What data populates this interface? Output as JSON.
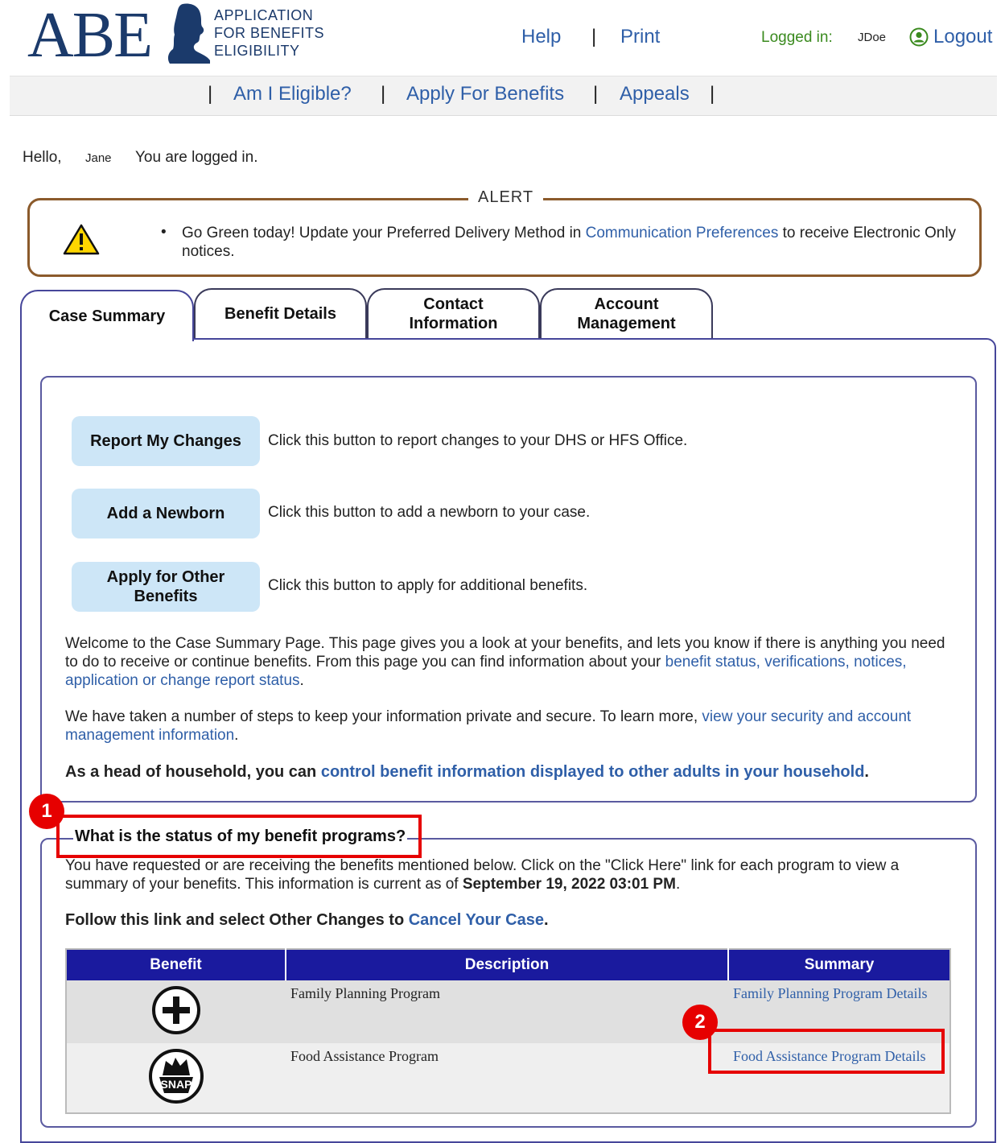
{
  "header": {
    "logo": "ABE",
    "logo_subtitle_1": "APPLICATION",
    "logo_subtitle_2": "FOR BENEFITS",
    "logo_subtitle_3": "ELIGIBILITY",
    "help": "Help",
    "separator": "|",
    "print": "Print",
    "logged_in_label": "Logged in:",
    "username": "JDoe",
    "logout": "Logout"
  },
  "nav": {
    "items": [
      "Am I Eligible?",
      "Apply For Benefits",
      "Appeals"
    ],
    "separator": "|"
  },
  "greeting": {
    "hello": "Hello,",
    "name": "Jane",
    "status": "You are logged in."
  },
  "alert": {
    "title": "ALERT",
    "bullet": "•",
    "text_before": "Go Green today! Update your Preferred Delivery Method in ",
    "link": "Communication Preferences",
    "text_after": " to receive Electronic Only notices.",
    "icon": "warning-icon"
  },
  "tabs": [
    "Case Summary",
    "Benefit Details",
    "Contact Information",
    "Account Management"
  ],
  "active_tab": "Case Summary",
  "actions": [
    {
      "label": "Report My Changes",
      "description": "Click this button to report changes to your DHS or HFS Office."
    },
    {
      "label": "Add a Newborn",
      "description": "Click this button to add a newborn to your case."
    },
    {
      "label": "Apply for Other Benefits",
      "description": "Click this button to apply for additional benefits."
    }
  ],
  "welcome": {
    "text": "Welcome to the Case Summary Page. This page gives you a look at your benefits, and lets you know if there is anything you need to do to receive or continue benefits. From this page you can find information about your ",
    "link": "benefit status, verifications, notices, application or change report status",
    "end": "."
  },
  "security": {
    "text": "We have taken a number of steps to keep your information private and secure. To learn more, ",
    "link": "view your security and account management information",
    "end": "."
  },
  "household": {
    "text": "As a head of household, you can ",
    "link": "control benefit information displayed to other adults in your household",
    "end": "."
  },
  "status_section": {
    "heading": "What is the status of my benefit programs?",
    "text": "You have requested or are receiving the benefits mentioned below. Click on the \"Click Here\" link for each program to view a summary of your benefits. This information is current as of ",
    "date": "September 19, 2022 03:01 PM",
    "end": ".",
    "cancel_text": "Follow this link and select Other Changes to ",
    "cancel_link": "Cancel Your Case",
    "cancel_end": "."
  },
  "table": {
    "headers": [
      "Benefit",
      "Description",
      "Summary"
    ],
    "rows": [
      {
        "icon": "plus-circle-icon",
        "description": "Family Planning Program",
        "summary": "Family Planning Program Details"
      },
      {
        "icon": "snap-icon",
        "icon_text": "SNAP",
        "description": "Food Assistance Program",
        "summary": "Food Assistance Program Details"
      }
    ]
  },
  "annotations": [
    "1",
    "2"
  ],
  "colors": {
    "link": "#2f5fa8",
    "table_header": "#1a1a9e",
    "button_bg": "#cde6f7",
    "annotation": "#e60000",
    "alert_border": "#8b5a2b",
    "logged_in": "#3a8a1e"
  }
}
